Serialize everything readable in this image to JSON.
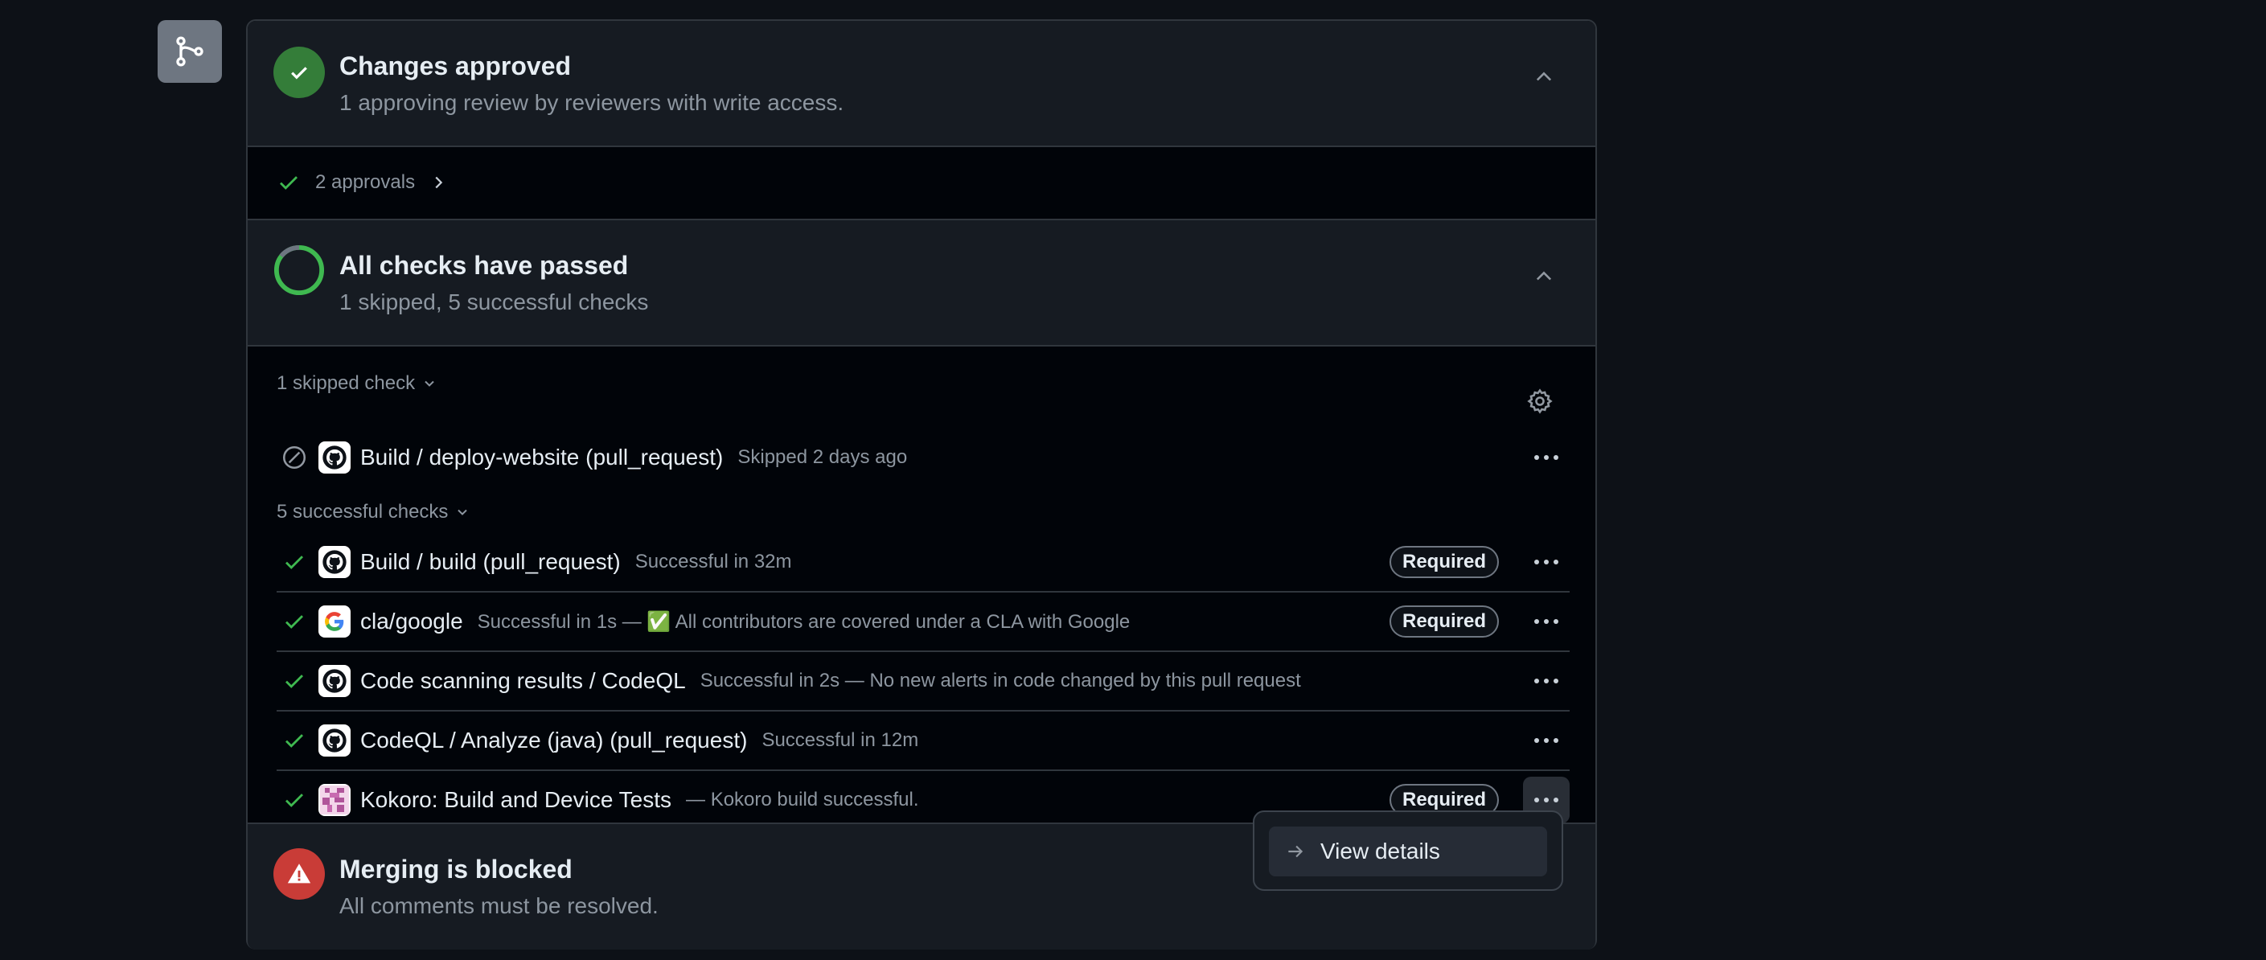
{
  "approved": {
    "title": "Changes approved",
    "subtitle": "1 approving review by reviewers with write access.",
    "approvals_label": "2 approvals"
  },
  "checks": {
    "title": "All checks have passed",
    "subtitle": "1 skipped, 5 successful checks",
    "skipped_group_label": "1 skipped check",
    "successful_group_label": "5 successful checks",
    "skipped": [
      {
        "name": "Build / deploy-website (pull_request)",
        "desc": "Skipped 2 days ago",
        "icon": "github-icon"
      }
    ],
    "successful": [
      {
        "name": "Build / build (pull_request)",
        "desc": "Successful in 32m",
        "required": "Required",
        "icon": "github-icon"
      },
      {
        "name": "cla/google",
        "desc": "Successful in 1s — ✅ All contributors are covered under a CLA with Google",
        "required": "Required",
        "icon": "google-icon"
      },
      {
        "name": "Code scanning results / CodeQL",
        "desc": "Successful in 2s — No new alerts in code changed by this pull request",
        "icon": "github-icon"
      },
      {
        "name": "CodeQL / Analyze (java) (pull_request)",
        "desc": "Successful in 12m",
        "icon": "github-icon"
      },
      {
        "name": "Kokoro: Build and Device Tests",
        "desc": "— Kokoro build successful.",
        "required": "Required",
        "icon": "kokoro-icon"
      }
    ]
  },
  "merge": {
    "title": "Merging is blocked",
    "subtitle": "All comments must be resolved."
  },
  "popup": {
    "item_label": "View details"
  },
  "colors": {
    "success": "#3fb950",
    "success_bg": "#347d39",
    "danger_bg": "#c93c37",
    "panel_bg": "#161b22"
  }
}
